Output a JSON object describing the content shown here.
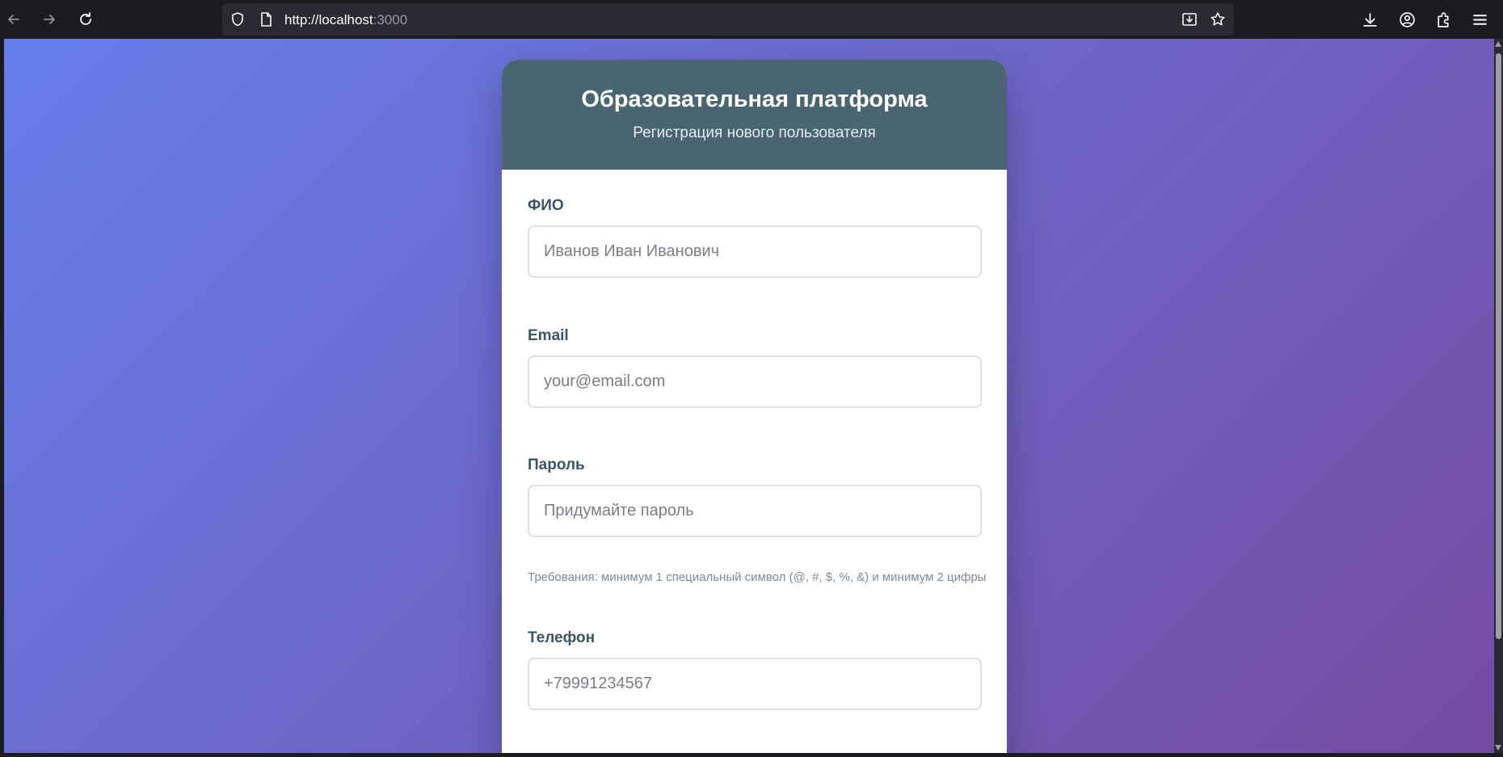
{
  "browser": {
    "url_host": "http://localhost",
    "url_port": ":3000",
    "icons": [
      "back-icon",
      "forward-icon",
      "reload-icon",
      "shield-icon",
      "page-icon",
      "save-page-icon",
      "bookmark-star-icon",
      "downloads-icon",
      "account-icon",
      "extensions-icon",
      "menu-icon"
    ]
  },
  "colors": {
    "gradient_start": "#667eea",
    "gradient_end": "#764ba2",
    "header_bg": "#4a6572",
    "label_color": "#3b5566"
  },
  "header": {
    "title": "Образовательная платформа",
    "subtitle": "Регистрация нового пользователя"
  },
  "form": {
    "fullname": {
      "label": "ФИО",
      "placeholder": "Иванов Иван Иванович",
      "value": ""
    },
    "email": {
      "label": "Email",
      "placeholder": "your@email.com",
      "value": ""
    },
    "password": {
      "label": "Пароль",
      "placeholder": "Придумайте пароль",
      "value": "",
      "hint": "Требования: минимум 1 специальный символ (@, #, $, %, &) и минимум 2 цифры"
    },
    "phone": {
      "label": "Телефон",
      "placeholder": "+79991234567",
      "value": ""
    }
  }
}
